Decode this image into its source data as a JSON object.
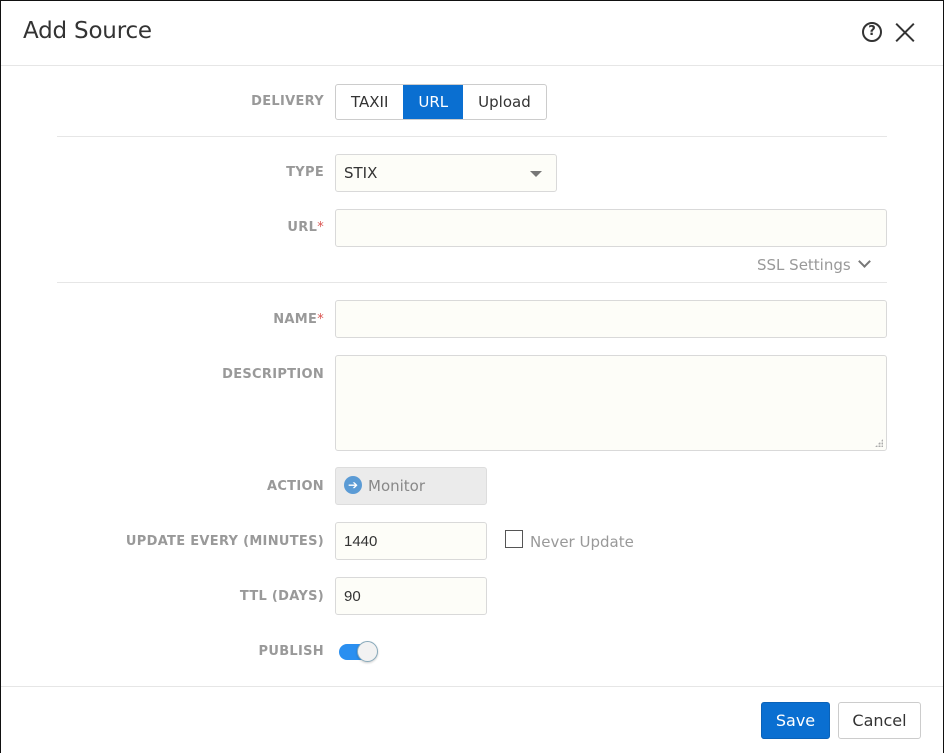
{
  "dialog": {
    "title": "Add Source",
    "help_icon": "question-circle-icon",
    "close_icon": "close-x-icon"
  },
  "form": {
    "delivery": {
      "label": "DELIVERY",
      "options": [
        "TAXII",
        "URL",
        "Upload"
      ],
      "selected": "URL"
    },
    "type": {
      "label": "TYPE",
      "value": "STIX",
      "icon": "caret-down-icon"
    },
    "url": {
      "label": "URL",
      "required_mark": "*",
      "value": "",
      "placeholder": ""
    },
    "ssl_settings": {
      "label": "SSL Settings",
      "icon": "chevron-down-icon"
    },
    "name": {
      "label": "NAME",
      "required_mark": "*",
      "value": "",
      "placeholder": ""
    },
    "description": {
      "label": "DESCRIPTION",
      "value": "",
      "placeholder": ""
    },
    "action": {
      "label": "ACTION",
      "value": "Monitor",
      "icon": "arrow-right-circle-icon",
      "icon_glyph": "➔"
    },
    "update_every": {
      "label": "UPDATE EVERY (MINUTES)",
      "value": "1440"
    },
    "never_update": {
      "label": "Never Update",
      "checked": false
    },
    "ttl": {
      "label": "TTL (DAYS)",
      "value": "90"
    },
    "publish": {
      "label": "PUBLISH",
      "on": true
    }
  },
  "footer": {
    "save_label": "Save",
    "cancel_label": "Cancel"
  },
  "colors": {
    "accent": "#0a6fd1",
    "toggle_on": "#2a8ff0",
    "required": "#d9534f",
    "label": "#999999"
  }
}
